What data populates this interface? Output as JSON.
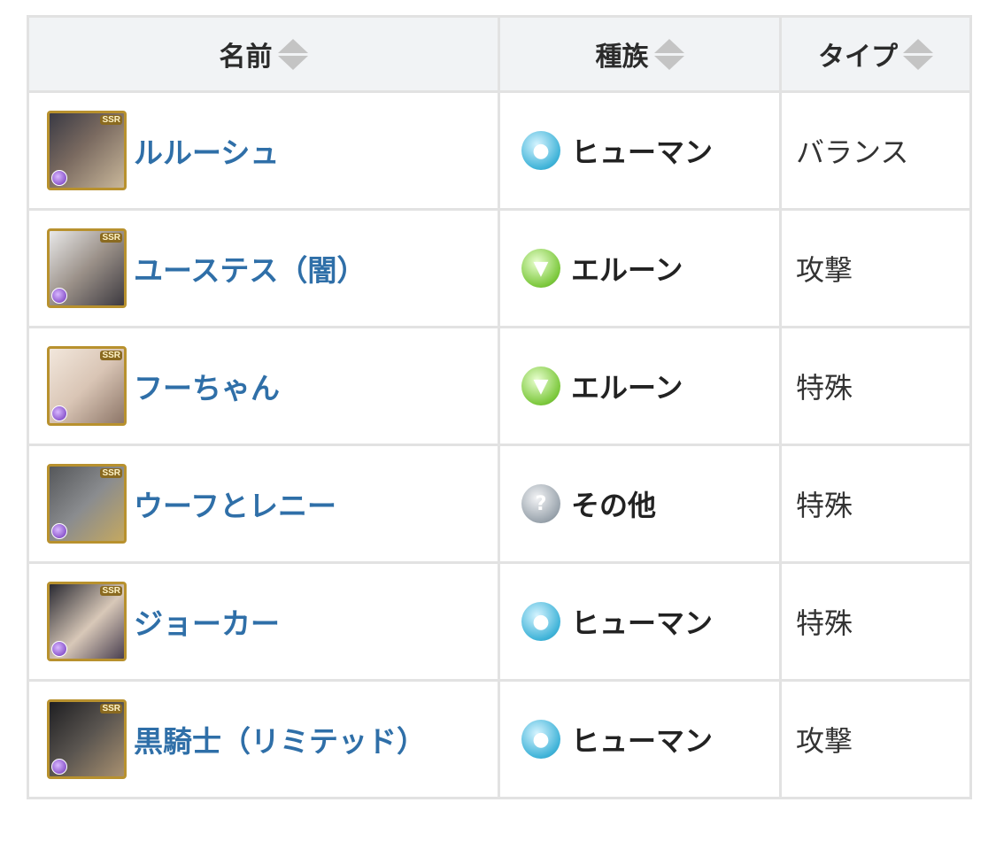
{
  "table": {
    "headers": {
      "name": "名前",
      "race": "種族",
      "type": "タイプ"
    },
    "rows": [
      {
        "name": "ルルーシュ",
        "race": "ヒューマン",
        "race_icon": "human-race-icon",
        "type": "バランス",
        "rarity": "SSR"
      },
      {
        "name": "ユーステス（闇）",
        "race": "エルーン",
        "race_icon": "erune-race-icon",
        "type": "攻撃",
        "rarity": "SSR"
      },
      {
        "name": "フーちゃん",
        "race": "エルーン",
        "race_icon": "erune-race-icon",
        "type": "特殊",
        "rarity": "SSR"
      },
      {
        "name": "ウーフとレニー",
        "race": "その他",
        "race_icon": "other-race-icon",
        "type": "特殊",
        "rarity": "SSR"
      },
      {
        "name": "ジョーカー",
        "race": "ヒューマン",
        "race_icon": "human-race-icon",
        "type": "特殊",
        "rarity": "SSR"
      },
      {
        "name": "黒騎士（リミテッド）",
        "race": "ヒューマン",
        "race_icon": "human-race-icon",
        "type": "攻撃",
        "rarity": "SSR"
      }
    ]
  },
  "colors": {
    "link": "#2f6fa8",
    "header_bg": "#f1f3f5",
    "border": "#e2e2e2",
    "human": "#3fb3d8",
    "erune": "#7cc83c",
    "other": "#9aa4ad",
    "dark_element": "#6b2fb8"
  }
}
